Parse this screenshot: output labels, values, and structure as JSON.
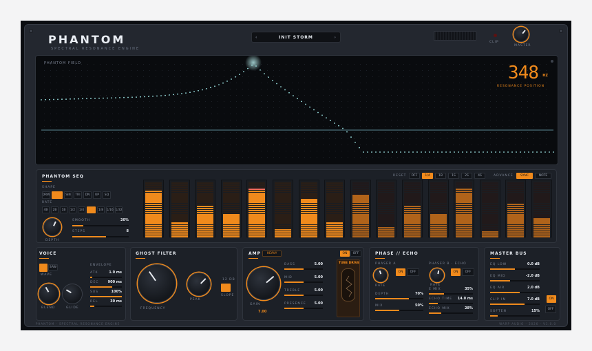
{
  "header": {
    "brand": "PHANTOM",
    "tagline": "SPECTRAL RESONANCE ENGINE",
    "preset_prev": "‹",
    "preset_name": "INIT STORM",
    "preset_next": "›",
    "clip_label": "CLIP",
    "master_label": "MASTER"
  },
  "field": {
    "label": "PHANTOM FIELD",
    "readout": "348",
    "unit": "HZ",
    "sub": "RESONANCE POSITION"
  },
  "seq": {
    "title": "PHANTOM SEQ",
    "reset_label": "RESET",
    "reset_opts": [
      "OFF",
      "1/4",
      "1B",
      "1S",
      "2S",
      "4S"
    ],
    "reset_active": 1,
    "advance_label": "ADVANCE",
    "advance_opts": [
      "SYNC",
      "NOTE"
    ],
    "advance_active": 0,
    "shape_label": "SHAPE",
    "shapes": [
      "DRW",
      "",
      "SIN",
      "TRI",
      "DN",
      "UP",
      "SQ"
    ],
    "shape_active": 1,
    "rate_label": "RATE",
    "rates": [
      "4B",
      "2B",
      "1B",
      "1/2",
      "1/4",
      "",
      "1/8",
      "1/16",
      "1/32"
    ],
    "rate_active": 5,
    "depth_label": "DEPTH",
    "smooth_label": "SMOOTH",
    "smooth_value": "20%",
    "smooth_level": 0.2,
    "steps_label": "STEPS",
    "steps_value": "8",
    "steps_level": 0.6,
    "columns": [
      0.85,
      0.27,
      0.56,
      0.42,
      0.88,
      0.14,
      0.69,
      0.27,
      0.76,
      0.21,
      0.56,
      0.42,
      0.9,
      0.12,
      0.63,
      0.34
    ],
    "active_steps": 8,
    "playhead": 4
  },
  "voice": {
    "title": "VOICE",
    "wave_label": "WAVE",
    "saw": "SAW",
    "blend_label": "BLEND",
    "glide_label": "GLIDE",
    "env_label": "ENVELOPE",
    "env": [
      {
        "k": "ATK",
        "v": "1.0 ms",
        "l": 0.06
      },
      {
        "k": "DEC",
        "v": "900 ms",
        "l": 0.7
      },
      {
        "k": "SUS",
        "v": "100%",
        "l": 1.0
      },
      {
        "k": "REL",
        "v": "30 ms",
        "l": 0.14
      }
    ]
  },
  "ghost": {
    "title": "GHOST FILTER",
    "frequency_label": "FREQUENCY",
    "peak_label": "PEAK",
    "slope_label": "SLOPE",
    "slope_value": "12 dB"
  },
  "amp": {
    "title": "AMP",
    "mode": "HEAVY",
    "toggle_on": "ON",
    "toggle_off": "OFF",
    "gain_label": "GAIN",
    "gain_value": "7.00",
    "tube_label": "TUBE DRIVE",
    "params": [
      {
        "k": "BASS",
        "v": "5.00",
        "l": 0.5
      },
      {
        "k": "MID",
        "v": "5.00",
        "l": 0.5
      },
      {
        "k": "TREBLE",
        "v": "5.00",
        "l": 0.5
      },
      {
        "k": "PRESENCE",
        "v": "5.00",
        "l": 0.5
      }
    ]
  },
  "phase": {
    "title": "PHASE // ECHO",
    "a_label": "PHASER A",
    "b_label": "PHASER B · ECHO",
    "on": "ON",
    "off": "OFF",
    "rate_label": "RATE",
    "a_params": [
      {
        "k": "DEPTH",
        "v": "70%",
        "l": 0.7
      },
      {
        "k": "MIX",
        "v": "50%",
        "l": 0.5
      }
    ],
    "b_params": [
      {
        "k": "E MIX",
        "v": "35%",
        "l": 0.35
      },
      {
        "k": "ECHO TIME",
        "v": "14.0 ms",
        "l": 0.2
      },
      {
        "k": "ECHO MIX",
        "v": "28%",
        "l": 0.28
      }
    ]
  },
  "master": {
    "title": "MASTER BUS",
    "on": "ON",
    "off": "OFF",
    "params": [
      {
        "k": "EQ LOW",
        "v": "0.0 dB",
        "l": 0.5
      },
      {
        "k": "EQ MID",
        "v": "-2.0 dB",
        "l": 0.4
      },
      {
        "k": "EQ AIR",
        "v": "2.0 dB",
        "l": 0.6
      },
      {
        "k": "CLIP IN",
        "v": "7.0 dB",
        "l": 0.7
      },
      {
        "k": "SOFTEN",
        "v": "15%",
        "l": 0.15
      }
    ]
  },
  "footer": {
    "left": "PHANTOM · SPECTRAL RESONANCE ENGINE",
    "right": "WARP AUDIO · 2026 · V1.0.0"
  },
  "colors": {
    "accent": "#f08a1c",
    "trace": "#9fe6e6"
  }
}
